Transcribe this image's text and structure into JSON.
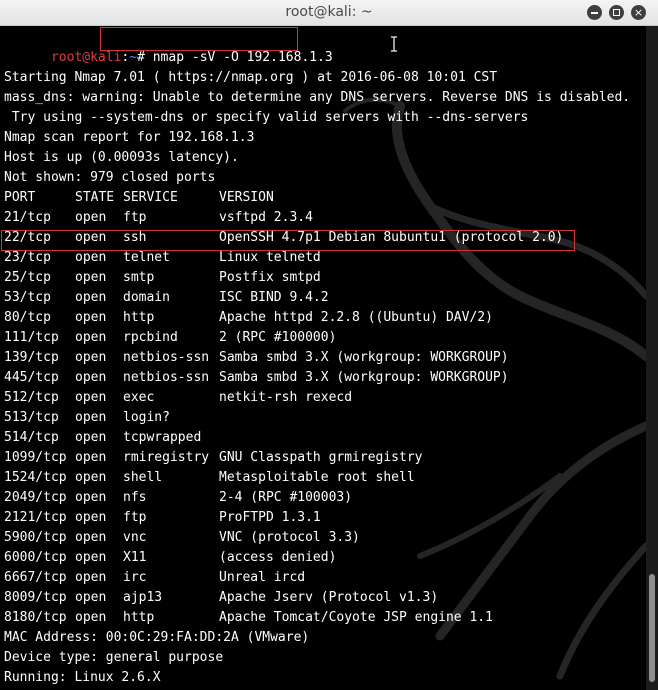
{
  "window": {
    "title": "root@kali: ~",
    "buttons": {
      "minimize_icon": "minimize-icon",
      "maximize_icon": "maximize-icon",
      "close_icon": "close-icon",
      "close_glyph": "×"
    }
  },
  "prompt": {
    "user_host": "root@kali",
    "sep": ":",
    "path": "~",
    "symbol": "#",
    "command": "nmap -sV -O 192.168.1.3"
  },
  "output": {
    "starting": "Starting Nmap 7.01 ( https://nmap.org ) at 2016-06-08 10:01 CST",
    "warning1": "mass_dns: warning: Unable to determine any DNS servers. Reverse DNS is disabled.",
    "warning2": " Try using --system-dns or specify valid servers with --dns-servers",
    "report": "Nmap scan report for 192.168.1.3",
    "host_up": "Host is up (0.00093s latency).",
    "not_shown": "Not shown: 979 closed ports",
    "mac": "MAC Address: 00:0C:29:FA:DD:2A (VMware)",
    "device_type": "Device type: general purpose",
    "running": "Running: Linux 2.6.X"
  },
  "ports_table": {
    "headers": {
      "port": "PORT",
      "state": "STATE",
      "service": "SERVICE",
      "version": "VERSION"
    },
    "rows": [
      {
        "port": "21/tcp",
        "state": "open",
        "service": "ftp",
        "version": "vsftpd 2.3.4"
      },
      {
        "port": "22/tcp",
        "state": "open",
        "service": "ssh",
        "version": "OpenSSH 4.7p1 Debian 8ubuntu1 (protocol 2.0)"
      },
      {
        "port": "23/tcp",
        "state": "open",
        "service": "telnet",
        "version": "Linux telnetd"
      },
      {
        "port": "25/tcp",
        "state": "open",
        "service": "smtp",
        "version": "Postfix smtpd"
      },
      {
        "port": "53/tcp",
        "state": "open",
        "service": "domain",
        "version": "ISC BIND 9.4.2"
      },
      {
        "port": "80/tcp",
        "state": "open",
        "service": "http",
        "version": "Apache httpd 2.2.8 ((Ubuntu) DAV/2)"
      },
      {
        "port": "111/tcp",
        "state": "open",
        "service": "rpcbind",
        "version": "2 (RPC #100000)"
      },
      {
        "port": "139/tcp",
        "state": "open",
        "service": "netbios-ssn",
        "version": "Samba smbd 3.X (workgroup: WORKGROUP)"
      },
      {
        "port": "445/tcp",
        "state": "open",
        "service": "netbios-ssn",
        "version": "Samba smbd 3.X (workgroup: WORKGROUP)"
      },
      {
        "port": "512/tcp",
        "state": "open",
        "service": "exec",
        "version": "netkit-rsh rexecd"
      },
      {
        "port": "513/tcp",
        "state": "open",
        "service": "login?",
        "version": ""
      },
      {
        "port": "514/tcp",
        "state": "open",
        "service": "tcpwrapped",
        "version": ""
      },
      {
        "port": "1099/tcp",
        "state": "open",
        "service": "rmiregistry",
        "version": "GNU Classpath grmiregistry"
      },
      {
        "port": "1524/tcp",
        "state": "open",
        "service": "shell",
        "version": "Metasploitable root shell"
      },
      {
        "port": "2049/tcp",
        "state": "open",
        "service": "nfs",
        "version": "2-4 (RPC #100003)"
      },
      {
        "port": "2121/tcp",
        "state": "open",
        "service": "ftp",
        "version": "ProFTPD 1.3.1"
      },
      {
        "port": "5900/tcp",
        "state": "open",
        "service": "vnc",
        "version": "VNC (protocol 3.3)"
      },
      {
        "port": "6000/tcp",
        "state": "open",
        "service": "X11",
        "version": "(access denied)"
      },
      {
        "port": "6667/tcp",
        "state": "open",
        "service": "irc",
        "version": "Unreal ircd"
      },
      {
        "port": "8009/tcp",
        "state": "open",
        "service": "ajp13",
        "version": "Apache Jserv (Protocol v1.3)"
      },
      {
        "port": "8180/tcp",
        "state": "open",
        "service": "http",
        "version": "Apache Tomcat/Coyote JSP engine 1.1"
      }
    ]
  },
  "colors": {
    "background": "#000000",
    "text": "#ffffff",
    "prompt_user": "#e33b3b",
    "prompt_path": "#4d8df0",
    "highlight_box": "#d03535",
    "titlebar": "#ececec"
  },
  "icons": {
    "cursor": "text-cursor-icon",
    "watermark": "kali-dragon-watermark"
  }
}
